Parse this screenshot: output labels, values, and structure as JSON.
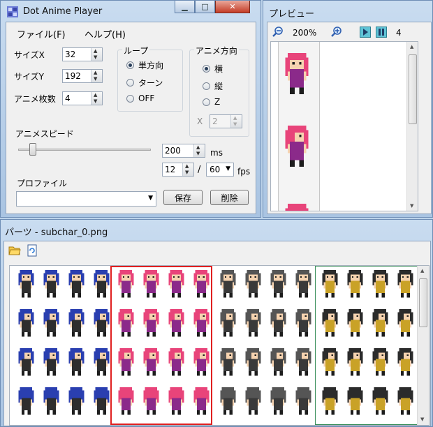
{
  "main_window": {
    "title": "Dot Anime Player",
    "menu": [
      "ファイル(F)",
      "ヘルプ(H)"
    ],
    "size_x_label": "サイズX",
    "size_x": "32",
    "size_y_label": "サイズY",
    "size_y": "192",
    "frames_label": "アニメ枚数",
    "frames": "4",
    "loop": {
      "title": "ループ",
      "options": [
        "単方向",
        "ターン",
        "OFF"
      ],
      "selected": "単方向"
    },
    "direction": {
      "title": "アニメ方向",
      "options": [
        "横",
        "縦",
        "Z"
      ],
      "selected": "横",
      "x_label": "X",
      "x_value": "2"
    },
    "speed_label": "アニメスピード",
    "speed_ms": "200",
    "ms_unit": "ms",
    "fps_value": "12",
    "slash": "/",
    "fps_select": "60",
    "fps_unit": "fps",
    "profile_label": "プロファイル",
    "save_button": "保存",
    "delete_button": "削除"
  },
  "preview_window": {
    "title": "プレビュー",
    "zoom": "200%",
    "frame_count": "4"
  },
  "parts_window": {
    "title": "パーツ - subchar_0.png"
  },
  "colors": {
    "selection_red": "#e02020",
    "selection_green": "#3a8f5a",
    "hair_blue": "#2a3fb0",
    "hair_pink": "#e8447a",
    "hair_gray": "#555555",
    "hair_dark": "#2b2b2b"
  },
  "icons": [
    "app-icon",
    "minimize-icon",
    "maximize-icon",
    "close-icon",
    "zoom-out-icon",
    "zoom-in-icon",
    "play-icon",
    "pause-icon",
    "open-folder-icon",
    "reload-icon"
  ]
}
